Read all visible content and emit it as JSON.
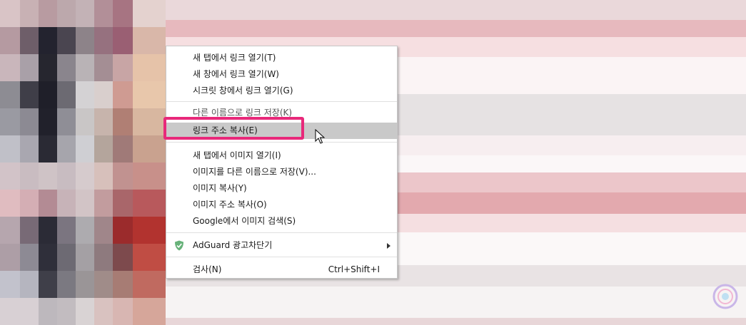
{
  "colors": {
    "highlight_border": "#e8297a",
    "menu_hover": "#c9c9c9",
    "adguard_green": "#67b279"
  },
  "context_menu": {
    "items": [
      {
        "label": "새 탭에서 링크 열기(T)"
      },
      {
        "label": "새 창에서 링크 열기(W)"
      },
      {
        "label": "시크릿 창에서 링크 열기(G)"
      },
      {
        "label": "다른 이름으로 링크 저장(K)"
      },
      {
        "label": "링크 주소 복사(E)"
      },
      {
        "label": "새 탭에서 이미지 열기(I)"
      },
      {
        "label": "이미지를 다른 이름으로 저장(V)..."
      },
      {
        "label": "이미지 복사(Y)"
      },
      {
        "label": "이미지 주소 복사(O)"
      },
      {
        "label": "Google에서 이미지 검색(S)"
      },
      {
        "label": "AdGuard 광고차단기",
        "icon": "adguard-shield-icon"
      },
      {
        "label": "검사(N)",
        "shortcut": "Ctrl+Shift+I"
      }
    ]
  }
}
